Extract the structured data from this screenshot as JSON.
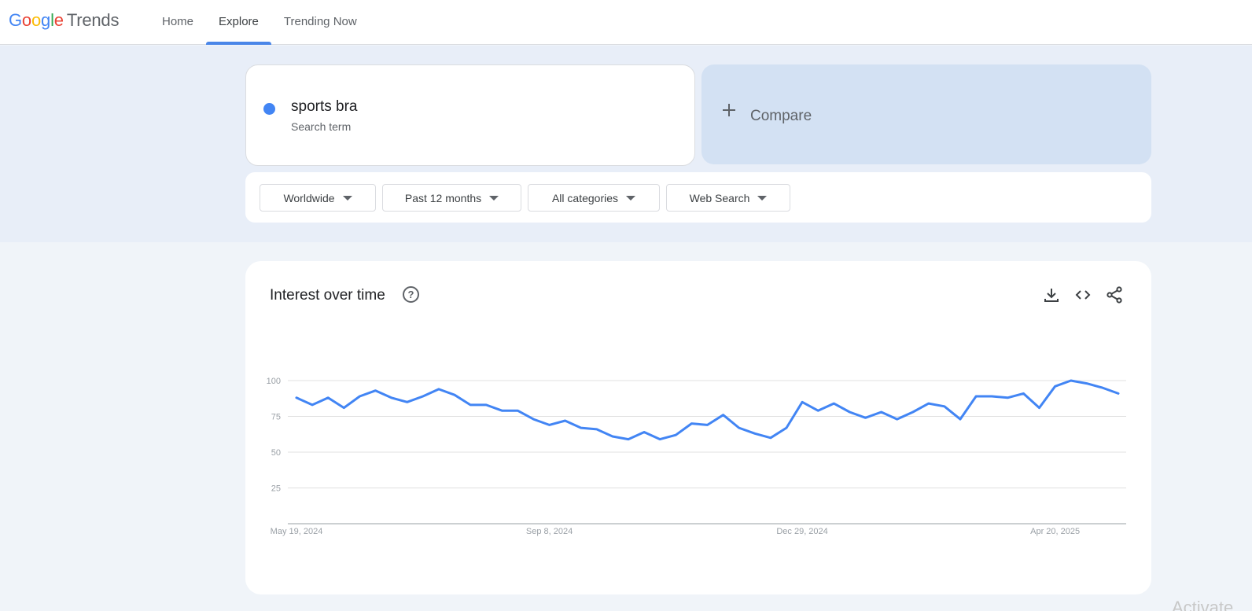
{
  "header": {
    "logo": {
      "letters": [
        "G",
        "o",
        "o",
        "g",
        "l",
        "e"
      ],
      "product": "Trends"
    },
    "tabs": [
      {
        "label": "Home",
        "active": false
      },
      {
        "label": "Explore",
        "active": true
      },
      {
        "label": "Trending Now",
        "active": false
      }
    ]
  },
  "search": {
    "term": "sports bra",
    "term_type": "Search term",
    "term_color": "#4285f4",
    "compare_label": "Compare"
  },
  "filters": [
    {
      "label": "Worldwide"
    },
    {
      "label": "Past 12 months"
    },
    {
      "label": "All categories"
    },
    {
      "label": "Web Search"
    }
  ],
  "interest_card": {
    "title": "Interest over time",
    "help_glyph": "?",
    "tools": [
      "download-icon",
      "embed-code-icon",
      "share-icon"
    ]
  },
  "chart_data": {
    "type": "line",
    "x_start": "2024-05-19",
    "x_end": "2025-05-11",
    "x_interval": "weekly",
    "x_ticks": [
      "May 19, 2024",
      "Sep 8, 2024",
      "Dec 29, 2024",
      "Apr 20, 2025"
    ],
    "y_ticks": [
      25,
      50,
      75,
      100
    ],
    "ylim": [
      0,
      100
    ],
    "grid": true,
    "line_color": "#4285f4",
    "series": [
      {
        "values": [
          88,
          83,
          88,
          81,
          89,
          93,
          88,
          85,
          89,
          94,
          90,
          83,
          83,
          79,
          79,
          73,
          69,
          72,
          67,
          66,
          61,
          59,
          64,
          59,
          62,
          70,
          69,
          76,
          67,
          63,
          60,
          67,
          85,
          79,
          84,
          78,
          74,
          78,
          73,
          78,
          84,
          82,
          73,
          89,
          89,
          88,
          91,
          81,
          96,
          100,
          98,
          95,
          91
        ]
      }
    ]
  },
  "watermark": "Activate W"
}
